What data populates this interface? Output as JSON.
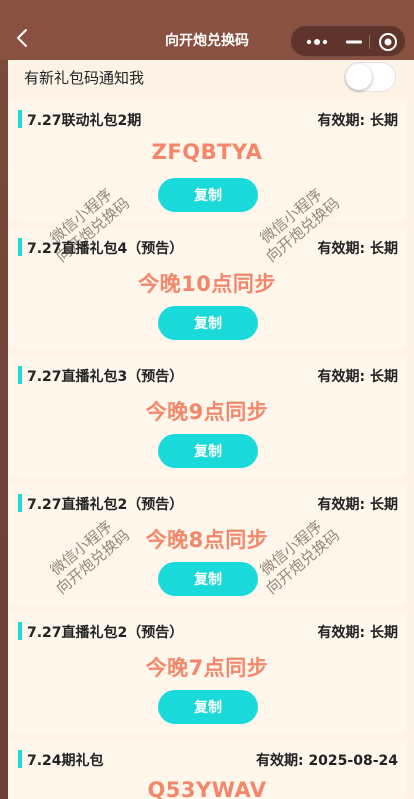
{
  "navbar": {
    "title": "向开炮兑换码",
    "back_icon": "back-chevron-icon",
    "more_icon": "more-dots-icon",
    "minimize_icon": "minimize-icon",
    "close_icon": "target-close-icon"
  },
  "notify": {
    "label": "有新礼包码通知我",
    "enabled": false
  },
  "codes": [
    {
      "name": "7.27联动礼包2期",
      "validity": "有效期: 长期",
      "code": "ZFQBTYA",
      "copy_label": "复制"
    },
    {
      "name": "7.27直播礼包4（预告）",
      "validity": "有效期: 长期",
      "code": "今晚10点同步",
      "copy_label": "复制"
    },
    {
      "name": "7.27直播礼包3（预告）",
      "validity": "有效期: 长期",
      "code": "今晚9点同步",
      "copy_label": "复制"
    },
    {
      "name": "7.27直播礼包2（预告）",
      "validity": "有效期: 长期",
      "code": "今晚8点同步",
      "copy_label": "复制"
    },
    {
      "name": "7.27直播礼包2（预告）",
      "validity": "有效期: 长期",
      "code": "今晚7点同步",
      "copy_label": "复制"
    },
    {
      "name": "7.24期礼包",
      "validity": "有效期: 2025-08-24",
      "code": "Q53YWAV",
      "copy_label": "复制"
    }
  ],
  "watermark": {
    "line1": "微信小程序",
    "line2": "向开炮兑换码"
  },
  "colors": {
    "navbar": "#8a5040",
    "accent": "#19d9d9",
    "code": "#f4876a",
    "background": "#fdf4e7"
  }
}
